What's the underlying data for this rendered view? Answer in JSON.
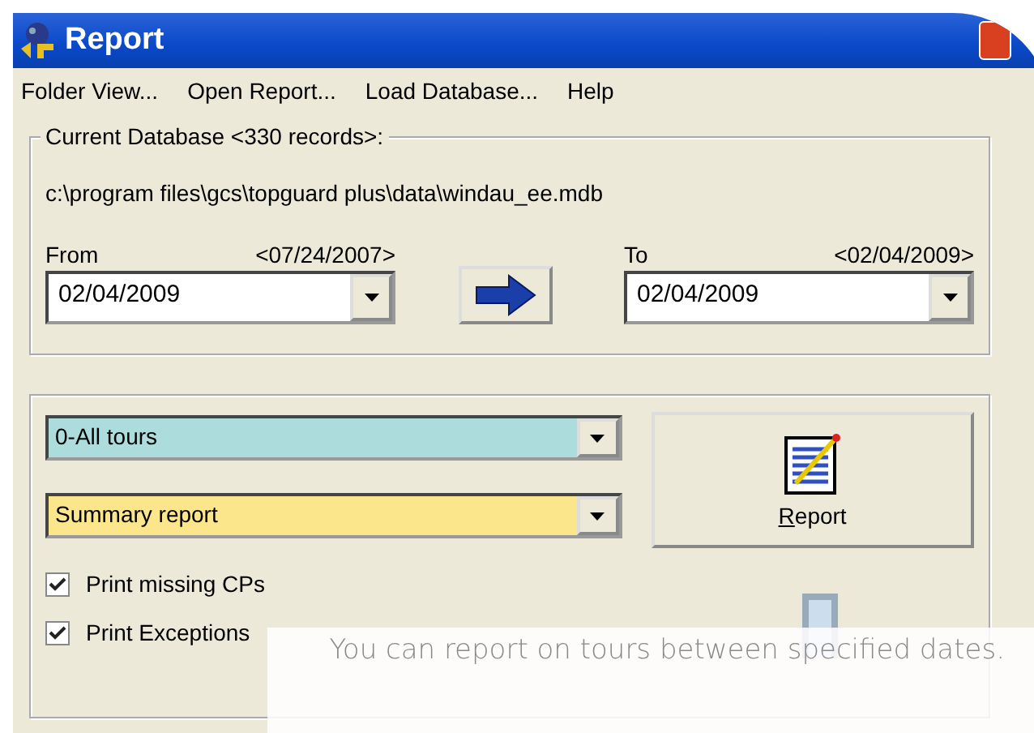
{
  "window": {
    "title": "Report"
  },
  "menu": [
    {
      "label": "Folder View..."
    },
    {
      "label": "Open Report..."
    },
    {
      "label": "Load Database..."
    },
    {
      "label": "Help"
    }
  ],
  "database": {
    "legend": "Current Database <330 records>:",
    "path": "c:\\program files\\gcs\\topguard plus\\data\\windau_ee.mdb"
  },
  "dates": [
    {
      "label": "From",
      "range": "<07/24/2007>",
      "value": "02/04/2009"
    },
    {
      "label": "To",
      "range": "<02/04/2009>",
      "value": "02/04/2009"
    }
  ],
  "dropdowns": [
    {
      "value": "0-All tours",
      "color": "#acdcdc"
    },
    {
      "value": "Summary report",
      "color": "#fce68c"
    }
  ],
  "report_button": {
    "label": "Report"
  },
  "options": [
    {
      "label": "Print missing CPs",
      "checked": true
    },
    {
      "label": "Print Exceptions",
      "checked": true
    }
  ],
  "caption": "You can report on tours between specified dates."
}
